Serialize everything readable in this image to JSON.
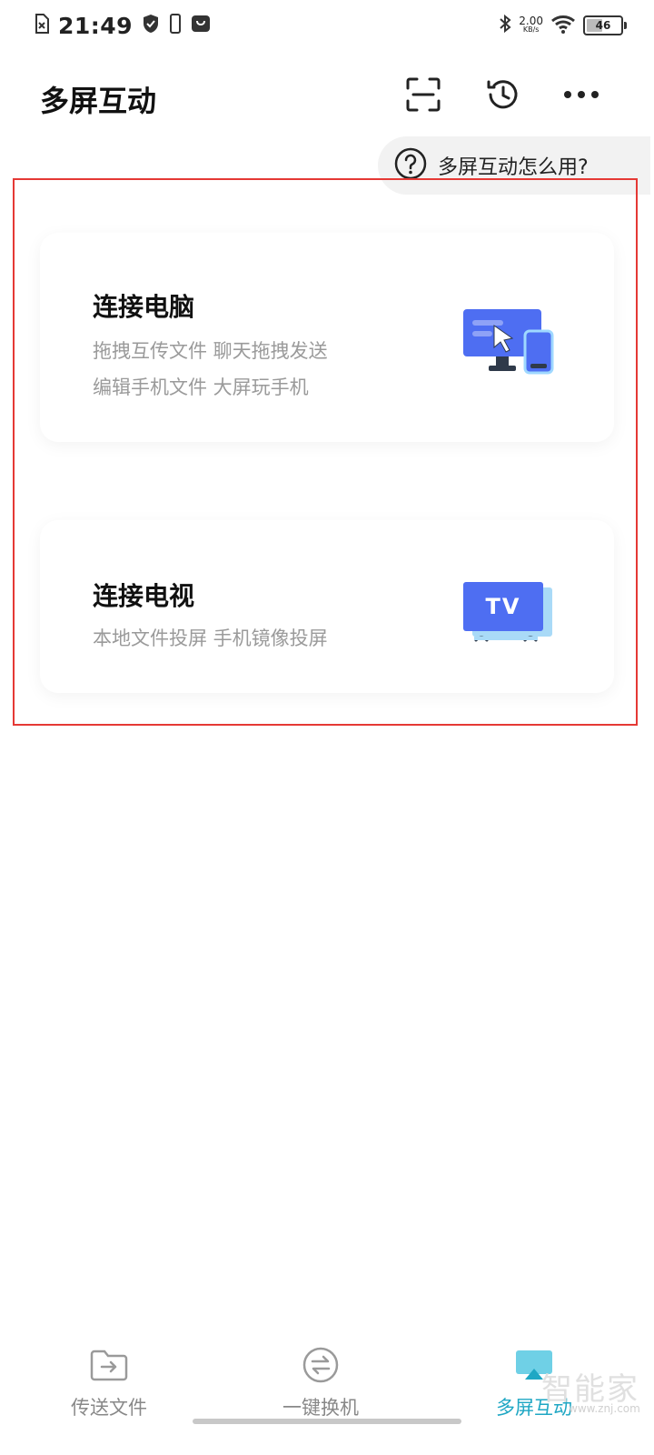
{
  "status_bar": {
    "time": "21:49",
    "net_speed_value": "2.00",
    "net_speed_unit": "KB/s",
    "battery": "46",
    "battery_level": 0.46,
    "icons": [
      "sim-error-icon",
      "shield-icon",
      "phone-icon",
      "bag-icon",
      "bluetooth-icon",
      "wifi-icon",
      "battery-icon"
    ]
  },
  "header": {
    "title": "多屏互动",
    "icons": [
      "scan-icon",
      "history-icon",
      "more-icon"
    ]
  },
  "help": {
    "label": "多屏互动怎么用?",
    "icon": "question-icon"
  },
  "cards": [
    {
      "title": "连接电脑",
      "lines": [
        "拖拽互传文件  聊天拖拽发送",
        "编辑手机文件  大屏玩手机"
      ],
      "icon": "computer-phone-icon"
    },
    {
      "title": "连接电视",
      "lines": [
        "本地文件投屏  手机镜像投屏"
      ],
      "icon": "tv-icon",
      "icon_text": "TV"
    }
  ],
  "bottom_nav": {
    "items": [
      {
        "label": "传送文件",
        "icon": "folder-transfer-icon",
        "active": false
      },
      {
        "label": "一键换机",
        "icon": "swap-icon",
        "active": false
      },
      {
        "label": "多屏互动",
        "icon": "screen-cast-icon",
        "active": true
      }
    ]
  },
  "watermark": {
    "text": "智能家",
    "url": "www.znj.com"
  },
  "colors": {
    "accent": "#1fa7c4",
    "highlight": "#e53935",
    "illustration": "#4e6ef2"
  }
}
